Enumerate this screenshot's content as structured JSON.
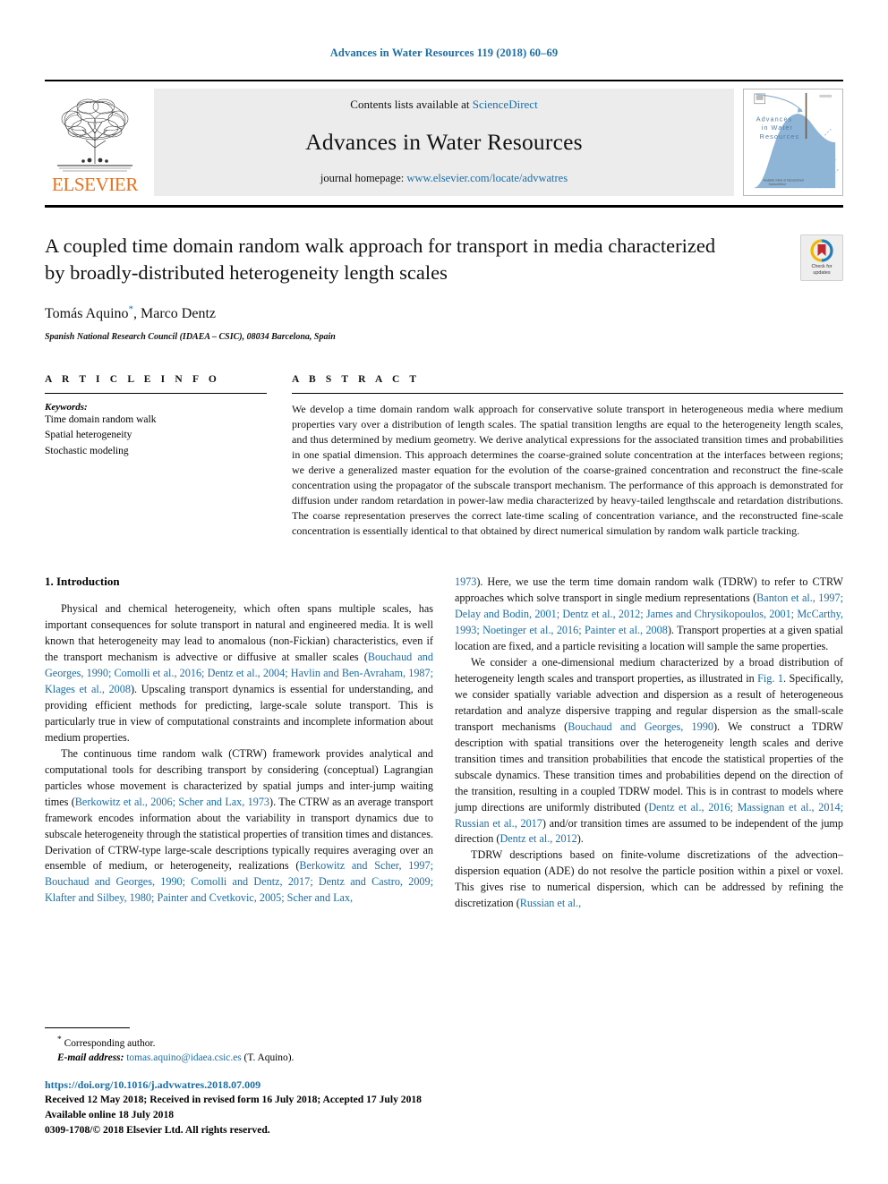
{
  "running_head": "Advances in Water Resources 119 (2018) 60–69",
  "masthead": {
    "contents_prefix": "Contents lists available at ",
    "sciencedirect": "ScienceDirect",
    "journal_title": "Advances in Water Resources",
    "homepage_prefix": "journal homepage: ",
    "homepage_url": "www.elsevier.com/locate/advwatres",
    "publisher": "ELSEVIER",
    "cover_title_line1": "Advances",
    "cover_title_line2": "in Water",
    "cover_title_line3": "Resources"
  },
  "crossmark": {
    "line1": "Check for",
    "line2": "updates"
  },
  "title": "A coupled time domain random walk approach for transport in media characterized by broadly-distributed heterogeneity length scales",
  "authors": "Tomás Aquino, Marco Dentz",
  "author_marker": "*",
  "affiliation": "Spanish National Research Council (IDAEA – CSIC), 08034 Barcelona, Spain",
  "article_info": {
    "heading": "A R T I C L E   I N F O",
    "keywords_label": "Keywords:",
    "keywords": [
      "Time domain random walk",
      "Spatial heterogeneity",
      "Stochastic modeling"
    ]
  },
  "abstract": {
    "heading": "A B S T R A C T",
    "text": "We develop a time domain random walk approach for conservative solute transport in heterogeneous media where medium properties vary over a distribution of length scales. The spatial transition lengths are equal to the heterogeneity length scales, and thus determined by medium geometry. We derive analytical expressions for the associated transition times and probabilities in one spatial dimension. This approach determines the coarse-grained solute concentration at the interfaces between regions; we derive a generalized master equation for the evolution of the coarse-grained concentration and reconstruct the fine-scale concentration using the propagator of the subscale transport mechanism. The performance of this approach is demonstrated for diffusion under random retardation in power-law media characterized by heavy-tailed lengthscale and retardation distributions. The coarse representation preserves the correct late-time scaling of concentration variance, and the reconstructed fine-scale concentration is essentially identical to that obtained by direct numerical simulation by random walk particle tracking."
  },
  "section": {
    "number_title": "1. Introduction"
  },
  "left_column": {
    "para1_a": "Physical and chemical heterogeneity, which often spans multiple scales, has important consequences for solute transport in natural and engineered media. It is well known that heterogeneity may lead to anomalous (non-Fickian) characteristics, even if the transport mechanism is advective or diffusive at smaller scales (",
    "para1_ref": "Bouchaud and Georges, 1990; Comolli et al., 2016; Dentz et al., 2004; Havlin and Ben-Avraham, 1987; Klages et al., 2008",
    "para1_b": "). Upscaling transport dynamics is essential for understanding, and providing efficient methods for predicting, large-scale solute transport. This is particularly true in view of computational constraints and incomplete information about medium properties.",
    "para2_a": "The continuous time random walk (CTRW) framework provides analytical and computational tools for describing transport by considering (conceptual) Lagrangian particles whose movement is characterized by spatial jumps and inter-jump waiting times (",
    "para2_ref": "Berkowitz et al., 2006; Scher and Lax, 1973",
    "para2_b": "). The CTRW as an average transport framework encodes information about the variability in transport dynamics due to subscale heterogeneity through the statistical properties of transition times and distances. Derivation of CTRW-type large-scale descriptions typically requires averaging over an ensemble of medium, or heterogeneity, realizations (",
    "para2_ref2": "Berkowitz and Scher, 1997; Bouchaud and Georges, 1990; Comolli and Dentz, 2017; Dentz and Castro, 2009; Klafter and Silbey, 1980; Painter and Cvetkovic, 2005; Scher and Lax,"
  },
  "right_column": {
    "para_cont_ref": "1973",
    "para_cont_a": "). Here, we use the term time domain random walk (TDRW) to refer to CTRW approaches which solve transport in single medium representations (",
    "para_cont_ref2": "Banton et al., 1997; Delay and Bodin, 2001; Dentz et al., 2012; James and Chrysikopoulos, 2001; McCarthy, 1993; Noetinger et al., 2016; Painter et al., 2008",
    "para_cont_b": "). Transport properties at a given spatial location are fixed, and a particle revisiting a location will sample the same properties.",
    "para2_a": "We consider a one-dimensional medium characterized by a broad distribution of heterogeneity length scales and transport properties, as illustrated in ",
    "para2_figref": "Fig. 1",
    "para2_b": ". Specifically, we consider spatially variable advection and dispersion as a result of heterogeneous retardation and analyze dispersive trapping and regular dispersion as the small-scale transport mechanisms (",
    "para2_ref": "Bouchaud and Georges, 1990",
    "para2_c": "). We construct a TDRW description with spatial transitions over the heterogeneity length scales and derive transition times and transition probabilities that encode the statistical properties of the subscale dynamics. These transition times and probabilities depend on the direction of the transition, resulting in a coupled TDRW model. This is in contrast to models where jump directions are uniformly distributed (",
    "para2_ref2": "Dentz et al., 2016; Massignan et al., 2014; Russian et al., 2017",
    "para2_d": ") and/or transition times are assumed to be independent of the jump direction (",
    "para2_ref3": "Dentz et al., 2012",
    "para2_e": ").",
    "para3_a": "TDRW descriptions based on finite-volume discretizations of the advection–dispersion equation (ADE) do not resolve the particle position within a pixel or voxel. This gives rise to numerical dispersion, which can be addressed by refining the discretization (",
    "para3_ref": "Russian et al.,"
  },
  "footer": {
    "corresponding_marker": "*",
    "corresponding_label": "Corresponding author.",
    "email_label": "E-mail address:",
    "email": "tomas.aquino@idaea.csic.es",
    "email_suffix": "(T. Aquino).",
    "doi": "https://doi.org/10.1016/j.advwatres.2018.07.009",
    "received": "Received 12 May 2018; Received in revised form 16 July 2018; Accepted 17 July 2018",
    "available": "Available online 18 July 2018",
    "copyright": "0309-1708/© 2018 Elsevier Ltd. All rights reserved."
  },
  "colors": {
    "link": "#1a6ea8",
    "elsevier_orange": "#E9711C",
    "masthead_gray": "#ececec"
  }
}
